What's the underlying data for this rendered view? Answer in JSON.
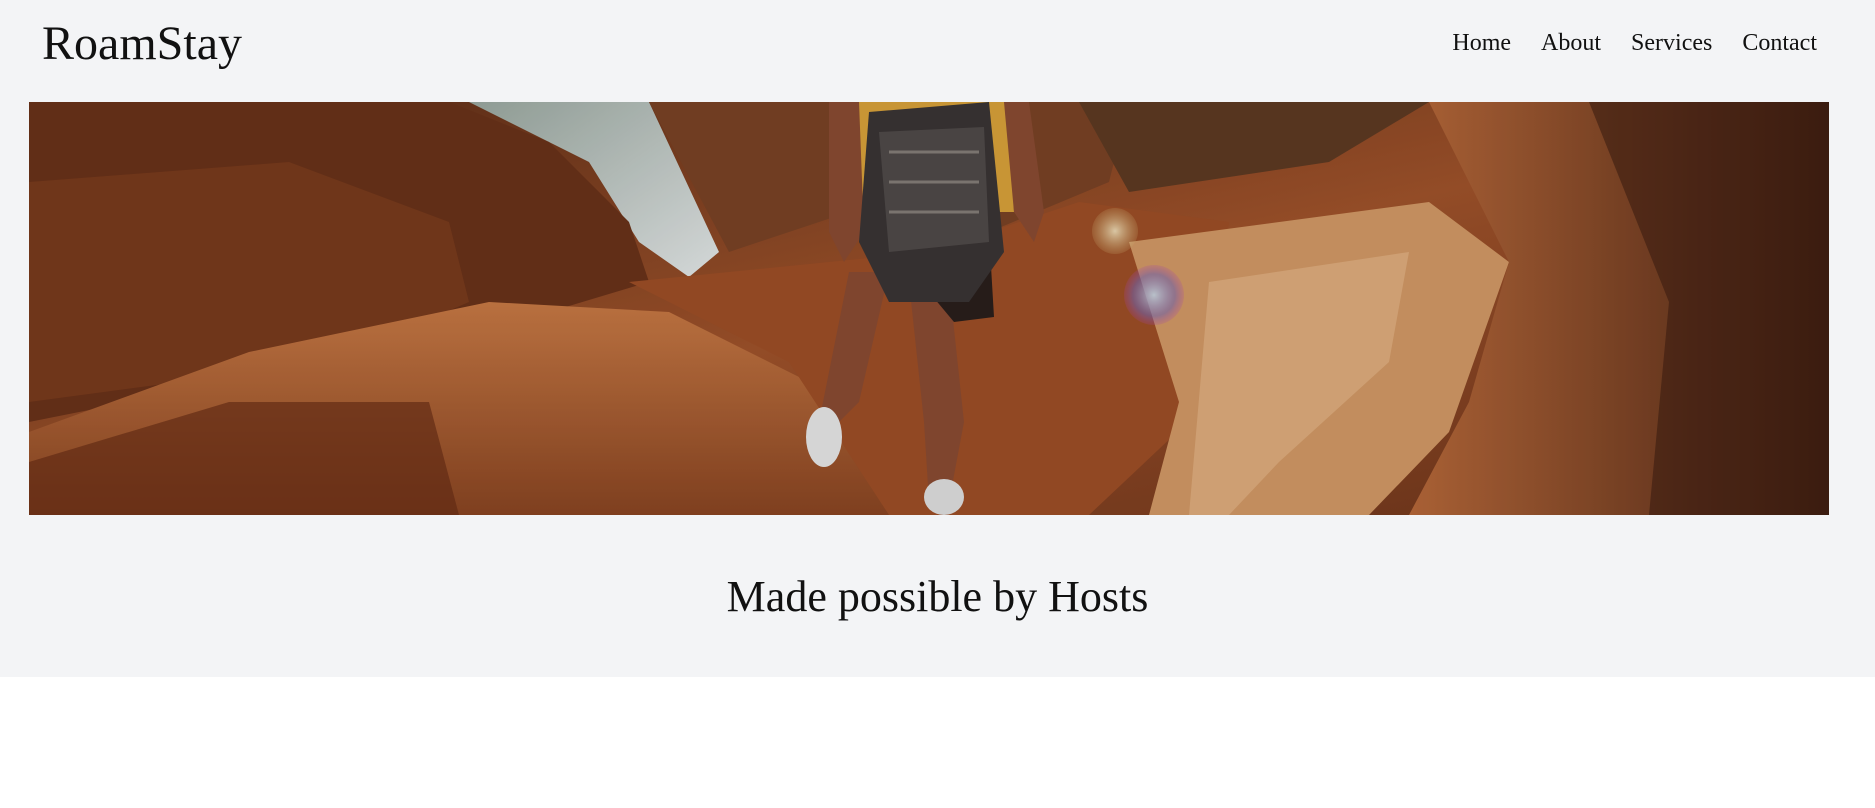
{
  "header": {
    "logo": "RoamStay",
    "nav": [
      {
        "label": "Home"
      },
      {
        "label": "About"
      },
      {
        "label": "Services"
      },
      {
        "label": "Contact"
      }
    ]
  },
  "hero": {
    "image_icon": "canyon-hiker-photo"
  },
  "tagline": "Made possible by Hosts",
  "colors": {
    "page_bg": "#f3f4f6",
    "content_bg": "#ffffff",
    "text": "#111111"
  }
}
